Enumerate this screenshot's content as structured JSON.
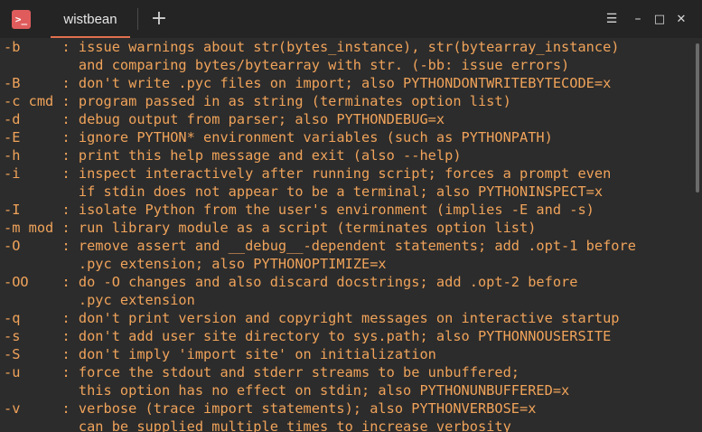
{
  "app": {
    "icon_glyph": ">_",
    "tab_title": "wistbean",
    "new_tab_glyph": "+"
  },
  "window_controls": {
    "menu_glyph": "☰",
    "minimize_glyph": "–",
    "maximize_glyph": "□",
    "close_glyph": "✕"
  },
  "colors": {
    "accent": "#e05c5c",
    "tab_underline": "#e0704d",
    "terminal_text": "#f0a35a",
    "terminal_bg": "#2c2c2c"
  },
  "terminal": {
    "lines": [
      "-b     : issue warnings about str(bytes_instance), str(bytearray_instance)",
      "         and comparing bytes/bytearray with str. (-bb: issue errors)",
      "-B     : don't write .pyc files on import; also PYTHONDONTWRITEBYTECODE=x",
      "-c cmd : program passed in as string (terminates option list)",
      "-d     : debug output from parser; also PYTHONDEBUG=x",
      "-E     : ignore PYTHON* environment variables (such as PYTHONPATH)",
      "-h     : print this help message and exit (also --help)",
      "-i     : inspect interactively after running script; forces a prompt even",
      "         if stdin does not appear to be a terminal; also PYTHONINSPECT=x",
      "-I     : isolate Python from the user's environment (implies -E and -s)",
      "-m mod : run library module as a script (terminates option list)",
      "-O     : remove assert and __debug__-dependent statements; add .opt-1 before",
      "         .pyc extension; also PYTHONOPTIMIZE=x",
      "-OO    : do -O changes and also discard docstrings; add .opt-2 before",
      "         .pyc extension",
      "-q     : don't print version and copyright messages on interactive startup",
      "-s     : don't add user site directory to sys.path; also PYTHONNOUSERSITE",
      "-S     : don't imply 'import site' on initialization",
      "-u     : force the stdout and stderr streams to be unbuffered;",
      "         this option has no effect on stdin; also PYTHONUNBUFFERED=x",
      "-v     : verbose (trace import statements); also PYTHONVERBOSE=x",
      "         can be supplied multiple times to increase verbosity"
    ]
  }
}
